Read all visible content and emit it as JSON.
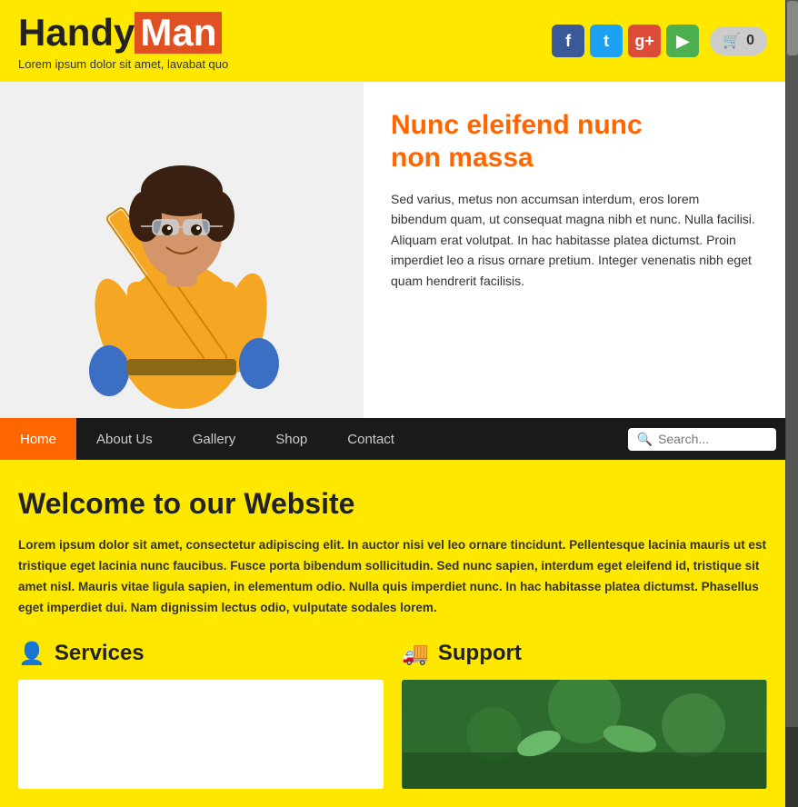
{
  "header": {
    "logo": {
      "handy": "Handy",
      "man": "Man",
      "subtitle": "Lorem ipsum dolor sit amet, lavabat quo"
    },
    "cart": {
      "count": "0"
    }
  },
  "hero": {
    "title": "Nunc eleifend nunc\nnon massa",
    "description": "Sed varius, metus non accumsan interdum, eros lorem bibendum quam, ut consequat magna nibh et nunc. Nulla facilisi. Aliquam erat volutpat. In hac habitasse platea dictumst. Proin imperdiet leo a risus ornare pretium. Integer venenatis nibh eget quam hendrerit facilisis."
  },
  "nav": {
    "items": [
      {
        "label": "Home",
        "active": true
      },
      {
        "label": "About Us",
        "active": false
      },
      {
        "label": "Gallery",
        "active": false
      },
      {
        "label": "Shop",
        "active": false
      },
      {
        "label": "Contact",
        "active": false
      }
    ],
    "search_placeholder": "Search..."
  },
  "main": {
    "welcome_title": "Welcome to our Website",
    "welcome_body": "Lorem ipsum dolor sit amet, consectetur adipiscing elit. In auctor nisi vel leo ornare tincidunt. Pellentesque lacinia mauris ut est tristique eget lacinia nunc faucibus. Fusce porta bibendum sollicitudin. Sed nunc sapien, interdum eget eleifend id, tristique sit amet nisl. Mauris vitae ligula sapien, in elementum odio. Nulla quis imperdiet nunc. In hac habitasse platea dictumst. Phasellus eget imperdiet dui. Nam dignissim lectus odio, vulputate sodales lorem.",
    "services_heading": "Services",
    "support_heading": "Support"
  },
  "colors": {
    "yellow": "#FFE800",
    "orange": "#FF6600",
    "dark": "#1a1a1a",
    "red_logo": "#E05020"
  }
}
